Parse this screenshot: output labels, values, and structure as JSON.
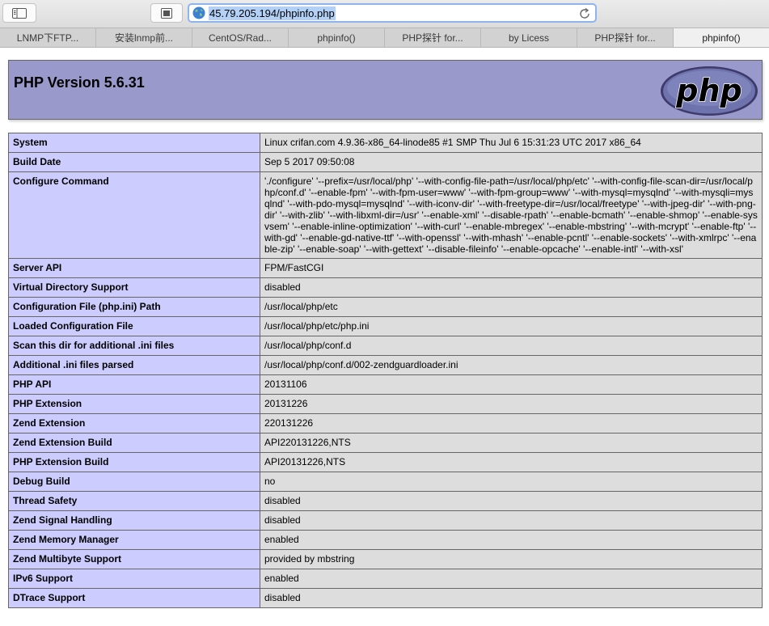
{
  "browser": {
    "url": "45.79.205.194/phpinfo.php",
    "tabs": [
      {
        "label": "LNMP下FTP..."
      },
      {
        "label": "安装lnmp前..."
      },
      {
        "label": "CentOS/Rad..."
      },
      {
        "label": "phpinfo()"
      },
      {
        "label": "PHP探针 for..."
      },
      {
        "label": "by Licess"
      },
      {
        "label": "PHP探针 for..."
      },
      {
        "label": "phpinfo()"
      }
    ],
    "active_tab_index": 7
  },
  "page": {
    "title": "PHP Version 5.6.31",
    "logo_text": "php",
    "rows": [
      {
        "key": "System",
        "value": "Linux crifan.com 4.9.36-x86_64-linode85 #1 SMP Thu Jul 6 15:31:23 UTC 2017 x86_64"
      },
      {
        "key": "Build Date",
        "value": "Sep 5 2017 09:50:08"
      },
      {
        "key": "Configure Command",
        "value": "'./configure' '--prefix=/usr/local/php' '--with-config-file-path=/usr/local/php/etc' '--with-config-file-scan-dir=/usr/local/php/conf.d' '--enable-fpm' '--with-fpm-user=www' '--with-fpm-group=www' '--with-mysql=mysqlnd' '--with-mysqli=mysqlnd' '--with-pdo-mysql=mysqlnd' '--with-iconv-dir' '--with-freetype-dir=/usr/local/freetype' '--with-jpeg-dir' '--with-png-dir' '--with-zlib' '--with-libxml-dir=/usr' '--enable-xml' '--disable-rpath' '--enable-bcmath' '--enable-shmop' '--enable-sysvsem' '--enable-inline-optimization' '--with-curl' '--enable-mbregex' '--enable-mbstring' '--with-mcrypt' '--enable-ftp' '--with-gd' '--enable-gd-native-ttf' '--with-openssl' '--with-mhash' '--enable-pcntl' '--enable-sockets' '--with-xmlrpc' '--enable-zip' '--enable-soap' '--with-gettext' '--disable-fileinfo' '--enable-opcache' '--enable-intl' '--with-xsl'"
      },
      {
        "key": "Server API",
        "value": "FPM/FastCGI"
      },
      {
        "key": "Virtual Directory Support",
        "value": "disabled"
      },
      {
        "key": "Configuration File (php.ini) Path",
        "value": "/usr/local/php/etc"
      },
      {
        "key": "Loaded Configuration File",
        "value": "/usr/local/php/etc/php.ini"
      },
      {
        "key": "Scan this dir for additional .ini files",
        "value": "/usr/local/php/conf.d"
      },
      {
        "key": "Additional .ini files parsed",
        "value": "/usr/local/php/conf.d/002-zendguardloader.ini"
      },
      {
        "key": "PHP API",
        "value": "20131106"
      },
      {
        "key": "PHP Extension",
        "value": "20131226"
      },
      {
        "key": "Zend Extension",
        "value": "220131226"
      },
      {
        "key": "Zend Extension Build",
        "value": "API220131226,NTS"
      },
      {
        "key": "PHP Extension Build",
        "value": "API20131226,NTS"
      },
      {
        "key": "Debug Build",
        "value": "no"
      },
      {
        "key": "Thread Safety",
        "value": "disabled"
      },
      {
        "key": "Zend Signal Handling",
        "value": "disabled"
      },
      {
        "key": "Zend Memory Manager",
        "value": "enabled"
      },
      {
        "key": "Zend Multibyte Support",
        "value": "provided by mbstring"
      },
      {
        "key": "IPv6 Support",
        "value": "enabled"
      },
      {
        "key": "DTrace Support",
        "value": "disabled"
      }
    ]
  },
  "colors": {
    "header_bg": "#9999cc",
    "key_cell_bg": "#ccccff",
    "value_cell_bg": "#dddddd"
  },
  "icons": {
    "sidebar": "sidebar-icon",
    "reader": "reader-icon",
    "site": "globe-icon",
    "reload": "reload-icon"
  }
}
